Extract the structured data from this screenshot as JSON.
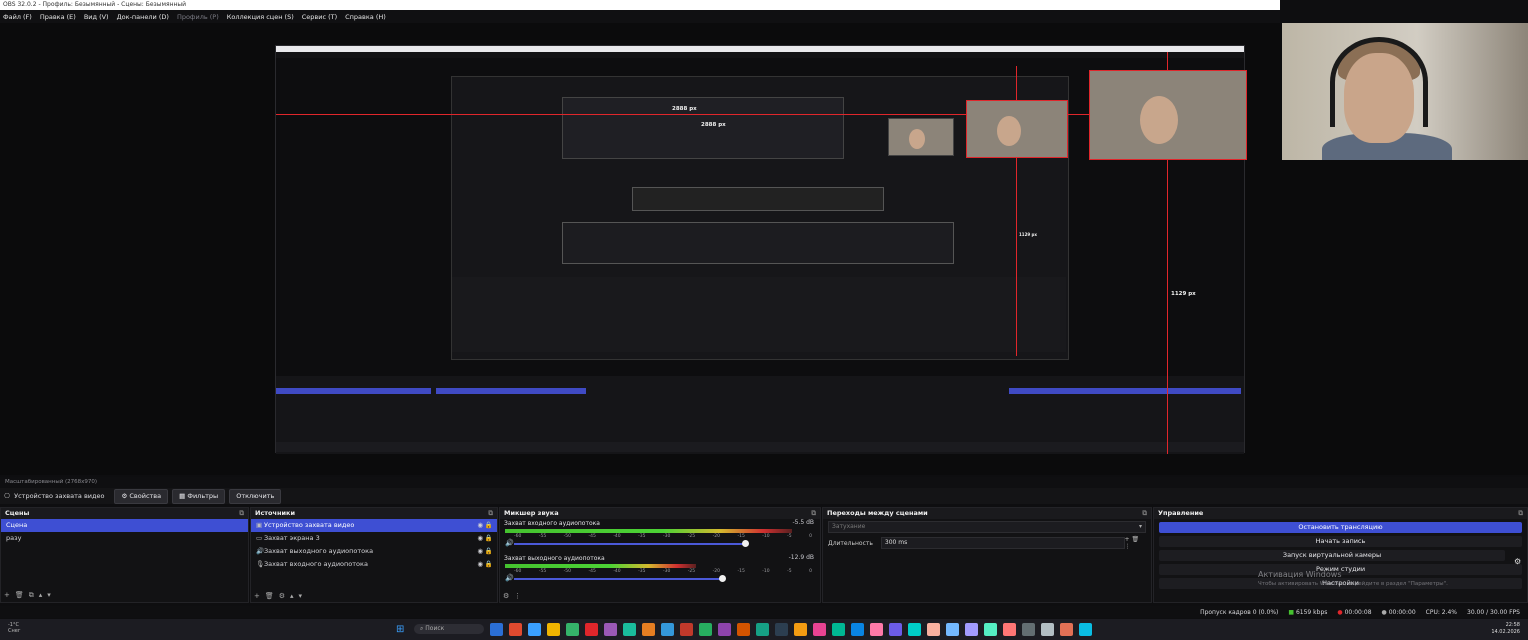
{
  "window": {
    "title": "OBS 32.0.2 - Профиль: Безымянный - Сцены: Безымянный"
  },
  "menu": [
    {
      "label": "Файл (F)",
      "enabled": true
    },
    {
      "label": "Правка (E)",
      "enabled": true
    },
    {
      "label": "Вид (V)",
      "enabled": true
    },
    {
      "label": "Док-панели (D)",
      "enabled": true
    },
    {
      "label": "Профиль (P)",
      "enabled": false
    },
    {
      "label": "Коллекция сцен (S)",
      "enabled": true
    },
    {
      "label": "Сервис (T)",
      "enabled": true
    },
    {
      "label": "Справка (H)",
      "enabled": true
    }
  ],
  "preview": {
    "measure_top": "2888 px",
    "measure_mid": "2888 px",
    "measure_right": "1129 px",
    "measure_right_small": "1129 px"
  },
  "source_bar": {
    "hint": "Масштабированный (2768x970)",
    "selected_source": "Устройство захвата видео",
    "properties": "Свойства",
    "filters": "Фильтры",
    "deactivate": "Отключить"
  },
  "scenes": {
    "title": "Сцены",
    "items": [
      {
        "label": "Сцена",
        "selected": true
      },
      {
        "label": "разу",
        "selected": false
      }
    ]
  },
  "sources": {
    "title": "Источники",
    "items": [
      {
        "label": "Устройство захвата видео",
        "icon": "camera-icon",
        "selected": true
      },
      {
        "label": "Захват экрана 3",
        "icon": "monitor-icon",
        "selected": false
      },
      {
        "label": "Захват выходного аудиопотока",
        "icon": "speaker-icon",
        "selected": false
      },
      {
        "label": "Захват входного аудиопотока",
        "icon": "microphone-icon",
        "selected": false
      }
    ]
  },
  "mixer": {
    "title": "Микшер звука",
    "channels": [
      {
        "name": "Захват входного аудиопотока",
        "db": "-5.5 dB",
        "level": 0.93,
        "volume": 0.78
      },
      {
        "name": "Захват выходного аудиопотока",
        "db": "-12.9 dB",
        "level": 0.6,
        "volume": 0.7
      }
    ],
    "ticks": [
      "-60",
      "-55",
      "-50",
      "-45",
      "-40",
      "-35",
      "-30",
      "-25",
      "-20",
      "-15",
      "-10",
      "-5",
      "0"
    ]
  },
  "transitions": {
    "title": "Переходы между сценами",
    "type_placeholder": "Затухание",
    "duration_label": "Длительность",
    "duration_value": "300 ms"
  },
  "controls": {
    "title": "Управление",
    "stop_stream": "Остановить трансляцию",
    "start_recording": "Начать запись",
    "virtual_camera": "Запуск виртуальной камеры",
    "studio_mode": "Режим студии",
    "settings": "Настройки"
  },
  "watermark": {
    "line1": "Активация Windows",
    "line2": "Чтобы активировать Windows, перейдите в раздел \"Параметры\"."
  },
  "status": {
    "dropped": "Пропуск кадров 0 (0.0%)",
    "bitrate": "6159 kbps",
    "stream_time": "00:00:08",
    "rec_time": "00:00:00",
    "cpu": "CPU: 2.4%",
    "fps": "30.00 / 30.00 FPS"
  },
  "taskbar": {
    "weather_temp": "-1°C",
    "weather_desc": "Снег",
    "search_placeholder": "Поиск",
    "time": "22:58",
    "date": "14.02.2026"
  },
  "colors": {
    "accent": "#3e4fd3",
    "red_guides": "#e0262b",
    "meter_green": "#45c22f",
    "meter_yellow": "#d4b92e",
    "meter_red": "#d03030"
  }
}
